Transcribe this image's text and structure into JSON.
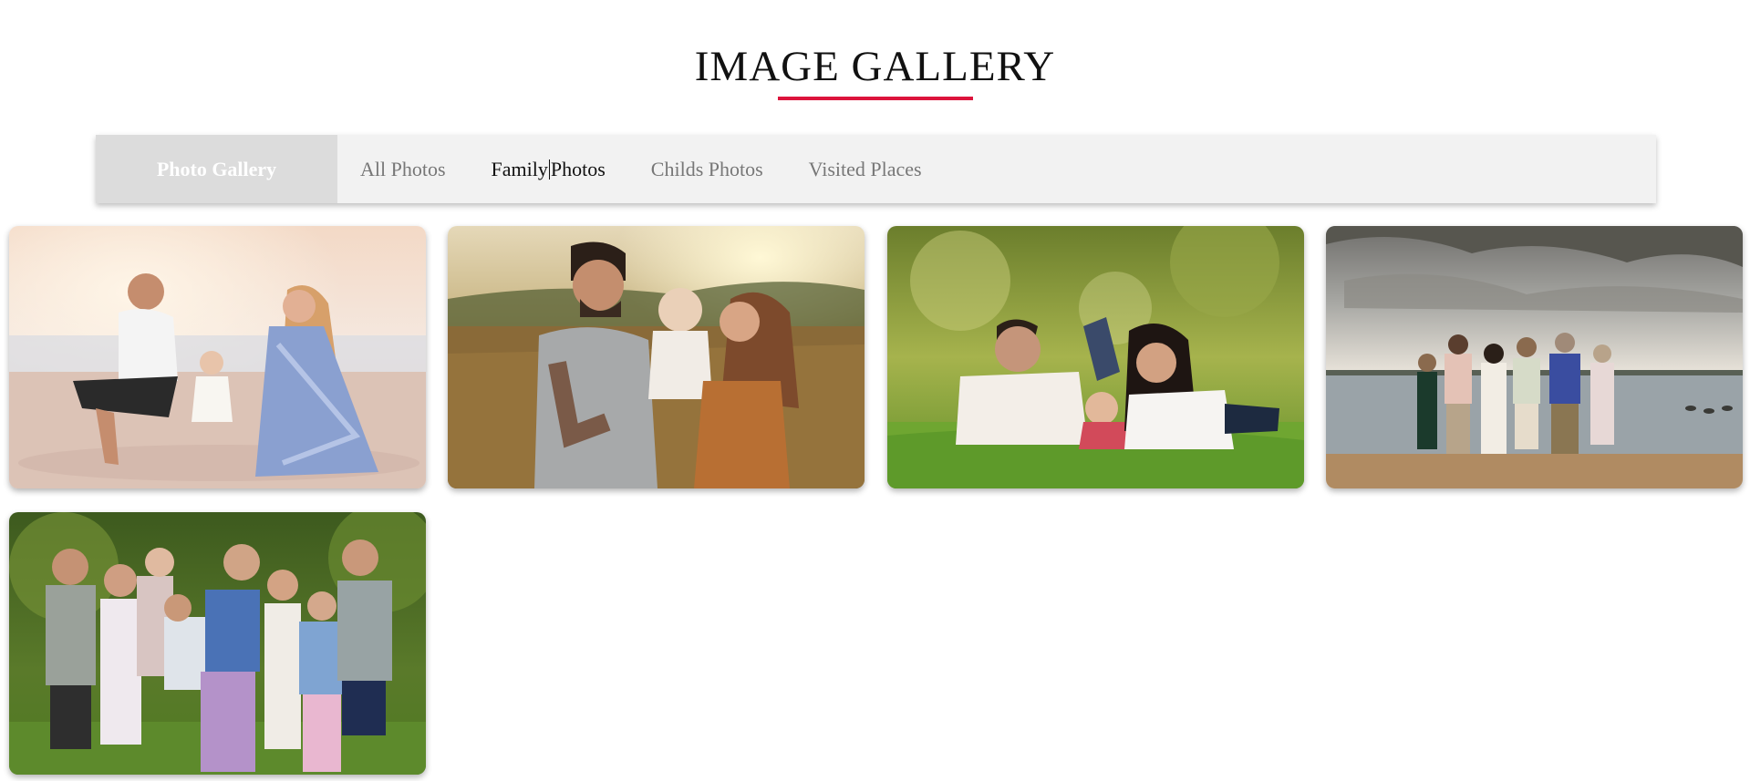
{
  "header": {
    "title": "IMAGE GALLERY",
    "accent_color": "#dc143c"
  },
  "filter_bar": {
    "brand_label": "Photo Gallery",
    "items": [
      {
        "label": "All Photos",
        "active": false
      },
      {
        "label_part1": "Family",
        "label_part2": "Photos",
        "active": true
      },
      {
        "label": "Childs Photos",
        "active": false
      },
      {
        "label": "Visited Places",
        "active": false
      }
    ]
  },
  "gallery": {
    "photos": [
      {
        "name": "family-beach-photo",
        "category": "Family Photos"
      },
      {
        "name": "couple-with-baby-field-photo",
        "category": "Family Photos"
      },
      {
        "name": "family-lying-on-grass-photo",
        "category": "Family Photos"
      },
      {
        "name": "family-at-lake-photo",
        "category": "Family Photos"
      },
      {
        "name": "extended-family-garden-photo",
        "category": "Family Photos"
      }
    ]
  }
}
